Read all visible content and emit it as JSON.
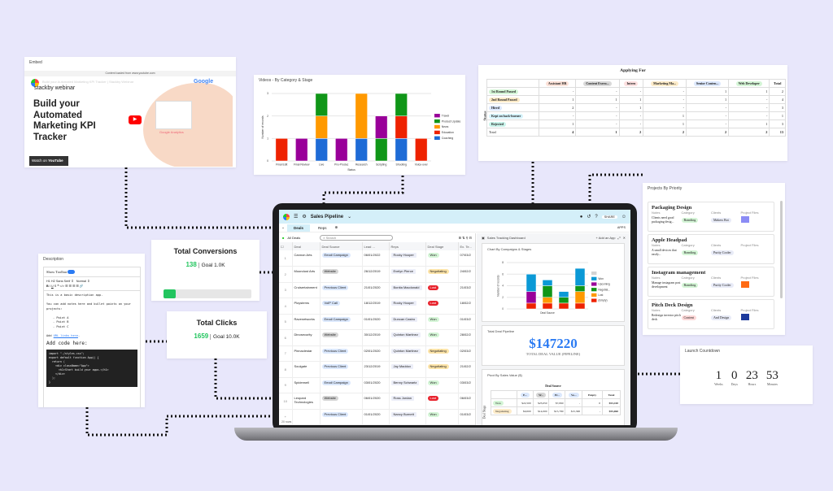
{
  "colors": {
    "background": "#e8e7fb",
    "accent": "#2b7bf3",
    "green": "#22c55e"
  },
  "embed": {
    "title": "Embed",
    "loaded_from": "Content loaded from www.youtube.com",
    "brand": "stackby webinar",
    "video_title": "Build your Automated Marketing KPI Tracker | Stackby Webinar",
    "headline": "Build your Automated Marketing KPI Tracker",
    "watch_on": "Watch on",
    "youtube": "YouTube",
    "google_badge": "Google",
    "analytics_label": "Google Analytics"
  },
  "chart_data": [
    {
      "type": "bar",
      "stacked": true,
      "title": "Videos - By Category & Stage",
      "xlabel": "Status",
      "ylabel": "Number of records",
      "ylim": [
        0,
        3
      ],
      "yticks": [
        0,
        1,
        2,
        3
      ],
      "legend": "right",
      "categories": [
        "Final Edit",
        "Final Review",
        "Live",
        "Pre-Production",
        "Research",
        "Scripting",
        "Shooting",
        "Voice-over Recording..."
      ],
      "series": [
        {
          "name": "Coaching",
          "color": "#1e6bd6",
          "values": [
            0,
            0,
            1,
            0,
            1,
            0,
            1,
            0
          ]
        },
        {
          "name": "Education",
          "color": "#ee2200",
          "values": [
            1,
            0,
            0,
            0,
            0,
            0,
            1,
            1
          ]
        },
        {
          "name": "News",
          "color": "#ff9900",
          "values": [
            0,
            0,
            1,
            0,
            2,
            0,
            0,
            0
          ]
        },
        {
          "name": "Product Update",
          "color": "#109618",
          "values": [
            0,
            0,
            1,
            0,
            0,
            1,
            1,
            0
          ]
        },
        {
          "name": "Travel",
          "color": "#990099",
          "values": [
            0,
            1,
            0,
            1,
            0,
            1,
            0,
            0
          ]
        }
      ]
    },
    {
      "type": "bar",
      "stacked": true,
      "title": "Chart By Campaigns & Stages",
      "xlabel": "Deal Source",
      "ylabel": "Number of records",
      "ylim": [
        0,
        8
      ],
      "yticks": [
        0,
        2,
        4,
        6,
        8
      ],
      "legend": "right",
      "categories": [
        "",
        "",
        "",
        "",
        ""
      ],
      "series": [
        {
          "name": "(Empty)",
          "color": "#ee2200",
          "values": [
            0,
            1,
            1,
            1,
            1
          ]
        },
        {
          "name": "Lost",
          "color": "#ff9900",
          "values": [
            0,
            0,
            1,
            0,
            2
          ]
        },
        {
          "name": "Negotiat...",
          "color": "#109618",
          "values": [
            0,
            0,
            2,
            1,
            1
          ]
        },
        {
          "name": "Upcoming",
          "color": "#990099",
          "values": [
            0,
            2,
            0,
            0,
            0
          ]
        },
        {
          "name": "Won",
          "color": "#0b99d6",
          "values": [
            0,
            3,
            1,
            1,
            3
          ]
        },
        {
          "name": "",
          "color": "#d3d3d3",
          "values": [
            0,
            0,
            0,
            0,
            0
          ]
        }
      ]
    }
  ],
  "applying": {
    "title": "Applying For",
    "row_axis": "Status",
    "columns": [
      "Assistant HR",
      "Content Execu...",
      "Intern",
      "Marketing Ma...",
      "Senior Conten...",
      "Web Developer"
    ],
    "col_colors": [
      "#fde2d8",
      "#d9d9d9",
      "#fde0e0",
      "#fdebc8",
      "#dce8fd",
      "#d4f5d6"
    ],
    "total_label": "Total",
    "rows": [
      {
        "label": "1st Round Passed",
        "color": "#d4f5d6",
        "cells": [
          "-",
          "-",
          "-",
          "-",
          "1",
          "1",
          "2"
        ]
      },
      {
        "label": "2nd Round Passed",
        "color": "#fdebc8",
        "cells": [
          "1",
          "1",
          "1",
          "-",
          "1",
          "-",
          "4"
        ]
      },
      {
        "label": "Hired",
        "color": "#dce8fd",
        "cells": [
          "2",
          "-",
          "1",
          "-",
          "-",
          "-",
          "3"
        ]
      },
      {
        "label": "Kept on back-burner",
        "color": "#d6f3fb",
        "cells": [
          "-",
          "-",
          "-",
          "1",
          "-",
          "-",
          "1"
        ]
      },
      {
        "label": "Rejected",
        "color": "#c8f3ea",
        "cells": [
          "1",
          "-",
          "-",
          "1",
          "-",
          "1",
          "3"
        ]
      }
    ],
    "totals": [
      "4",
      "1",
      "2",
      "2",
      "2",
      "2",
      "13"
    ]
  },
  "projects": {
    "title": "Projects By Priority",
    "field_labels": [
      "Notes",
      "Category",
      "Clients",
      "Project Files"
    ],
    "items": [
      {
        "name": "Packaging Design",
        "notes": "Clients need good packaging desig...",
        "category": "Branding",
        "cat_color": "#d4f5d6",
        "client": "Makers Bot",
        "file_color": "#8b8cf5"
      },
      {
        "name": "Apple Headpad",
        "notes": "A small devices that easily...",
        "category": "Branding",
        "cat_color": "#d4f5d6",
        "client": "Purity Cooler",
        "file_color": "#ffffff"
      },
      {
        "name": "Instagram management",
        "notes": "Manage instagram post development",
        "category": "Branding",
        "cat_color": "#d4f5d6",
        "client": "Purity Cooler",
        "file_color": "#ff6a13"
      },
      {
        "name": "Pitch Deck Design",
        "notes": "Redesign investor pitch deck",
        "category": "Content",
        "cat_color": "#fdd8d8",
        "client": "And Design",
        "file_color": "#1d3a9c"
      }
    ]
  },
  "conversions": {
    "title": "Total Conversions",
    "value": "138",
    "goal": "Goal 1.0K",
    "progress": 0.138
  },
  "clicks": {
    "title": "Total Clicks",
    "value": "1659",
    "goal": "Goal 10.0K"
  },
  "description": {
    "title": "Description",
    "show_toolbar": "Show Toolbar",
    "toolbar_on": true,
    "font": "Sans Serif",
    "size": "Normal",
    "h1": "H1",
    "h2": "H2",
    "lines": [
      "This is a basic description app.",
      "You can add notes here and bullet points on your projects:"
    ],
    "bullets": [
      "Point A",
      "Point B",
      "Point C"
    ],
    "add": "Add",
    "link": "URL links here",
    "code_heading": "Add code here:",
    "code": "import \"./styles.css\";\nexport default function App() {\n  return (\n    <div className=\"App\">\n      <h1>Start build your apps.</h1>\n    </div>\n  );\n}"
  },
  "countdown": {
    "title": "Launch Countdown",
    "units": [
      {
        "value": "1",
        "label": "Weeks"
      },
      {
        "value": "0",
        "label": "Days"
      },
      {
        "value": "23",
        "label": "Hours"
      },
      {
        "value": "53",
        "label": "Minutes"
      }
    ]
  },
  "app": {
    "title": "Sales Pipeline",
    "share": "SHARE",
    "apps": "APPS",
    "tabs": [
      "Deals",
      "Reps"
    ],
    "view": "All Deals",
    "search_placeholder": "Search",
    "columns": [
      "Deal",
      "Deal Source",
      "Lead ...",
      "Reps",
      "Deal Stage",
      "Ex. Te..."
    ],
    "rows": [
      {
        "deal": "Cannon Arts",
        "source": "Email Campaign",
        "date": "06/01/2022",
        "rep": "Rocky Hooper",
        "stage": "Won",
        "ex": "07/03/2"
      },
      {
        "deal": "Moondust Arts",
        "source": "Website",
        "date": "26/12/2019",
        "rep": "Evelyn Pierce",
        "stage": "Negotiating",
        "ex": "24/02/2"
      },
      {
        "deal": "Cruisertainment",
        "source": "Previous Client",
        "date": "21/01/2020",
        "rep": "Bonita Macdonald",
        "stage": "Lost",
        "ex": "21/03/2"
      },
      {
        "deal": "Ploystems",
        "source": "VoIP Call",
        "date": "18/12/2019",
        "rep": "Rocky Hooper",
        "stage": "Lost",
        "ex": "18/02/2"
      },
      {
        "deal": "Ravenetworks",
        "source": "Email Campaign",
        "date": "01/01/2020",
        "rep": "Duncan Castro",
        "stage": "Won",
        "ex": "01/03/2"
      },
      {
        "deal": "Dinosecurity",
        "source": "Website",
        "date": "30/12/2019",
        "rep": "Quinton Martinez",
        "stage": "Won",
        "ex": "28/02/2"
      },
      {
        "deal": "Pinnaclestar",
        "source": "Previous Client",
        "date": "02/01/2020",
        "rep": "Quinton Martinez",
        "stage": "Negotiating",
        "ex": "02/03/2"
      },
      {
        "deal": "Soulgate",
        "source": "Previous Client",
        "date": "23/12/2019",
        "rep": "Jay Maddox",
        "stage": "Negotiating",
        "ex": "21/02/2"
      },
      {
        "deal": "Spiderwell",
        "source": "Email Campaign",
        "date": "03/01/2020",
        "rep": "Benny Schwartz",
        "stage": "Won",
        "ex": "03/03/2"
      },
      {
        "deal": "Leopard Technologies",
        "source": "Website",
        "date": "06/01/2020",
        "rep": "Ross Jordan",
        "stage": "Lost",
        "ex": "06/03/2"
      },
      {
        "deal": "",
        "source": "Previous Client",
        "date": "01/01/2020",
        "rep": "Nancy Burnett",
        "stage": "Won",
        "ex": "01/03/2"
      }
    ],
    "row_count": "20 rows",
    "dashboard": {
      "title": "Sales Tracking Dashboard",
      "add_app": "Add an App",
      "pipeline_title": "Total Deal Pipeline",
      "pipeline_value": "$147220",
      "pipeline_caption": "TOTAL DEAL VALUE (PIPELINE)",
      "pivot_title": "Pivot By Sales Value ($)",
      "pivot_header": "Deal Source",
      "pivot_row_axis": "Deal Stage",
      "pivot_cols": [
        "E...",
        "W...",
        "Pr...",
        "Vo...",
        "Empty",
        "Total"
      ],
      "pivot_rows": [
        {
          "label": "Won",
          "color": "#d4f5d6",
          "cells": [
            "$22,500",
            "$23,650",
            "$7,060",
            "-",
            "0",
            "$53,410"
          ]
        },
        {
          "label": "Negotiating",
          "color": "#fdebc8",
          "cells": [
            "$9,000",
            "$14,000",
            "$15,780",
            "$15,300",
            "-",
            "$55,060"
          ]
        }
      ]
    }
  }
}
